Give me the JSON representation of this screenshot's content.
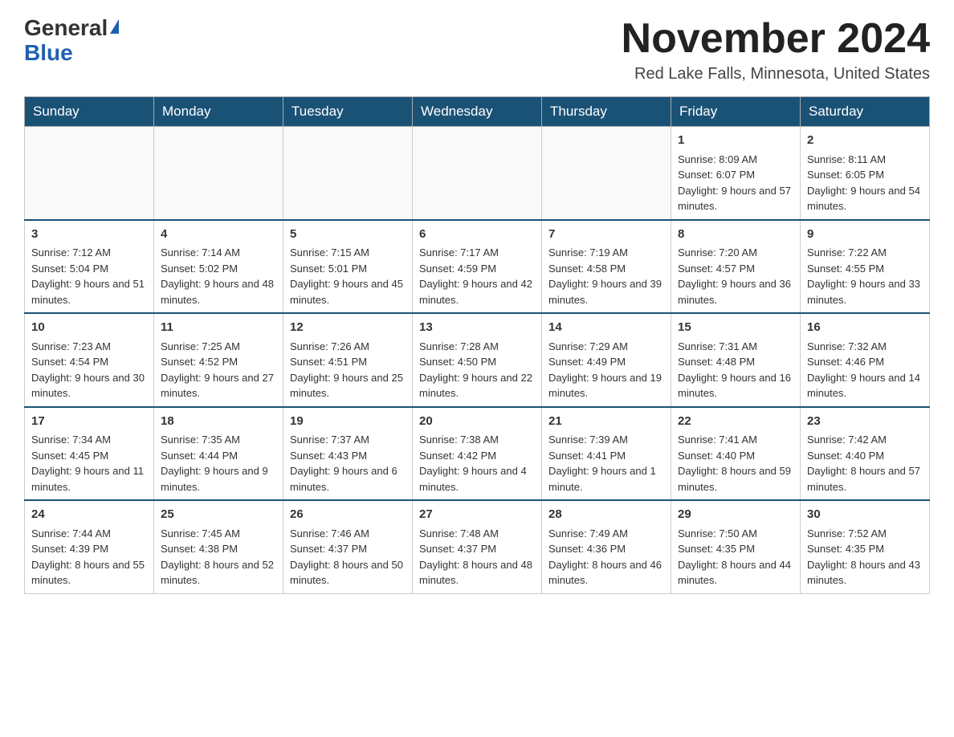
{
  "logo": {
    "general": "General",
    "blue": "Blue"
  },
  "header": {
    "month": "November 2024",
    "location": "Red Lake Falls, Minnesota, United States"
  },
  "weekdays": [
    "Sunday",
    "Monday",
    "Tuesday",
    "Wednesday",
    "Thursday",
    "Friday",
    "Saturday"
  ],
  "weeks": [
    [
      {
        "day": "",
        "data": ""
      },
      {
        "day": "",
        "data": ""
      },
      {
        "day": "",
        "data": ""
      },
      {
        "day": "",
        "data": ""
      },
      {
        "day": "",
        "data": ""
      },
      {
        "day": "1",
        "data": "Sunrise: 8:09 AM\nSunset: 6:07 PM\nDaylight: 9 hours and 57 minutes."
      },
      {
        "day": "2",
        "data": "Sunrise: 8:11 AM\nSunset: 6:05 PM\nDaylight: 9 hours and 54 minutes."
      }
    ],
    [
      {
        "day": "3",
        "data": "Sunrise: 7:12 AM\nSunset: 5:04 PM\nDaylight: 9 hours and 51 minutes."
      },
      {
        "day": "4",
        "data": "Sunrise: 7:14 AM\nSunset: 5:02 PM\nDaylight: 9 hours and 48 minutes."
      },
      {
        "day": "5",
        "data": "Sunrise: 7:15 AM\nSunset: 5:01 PM\nDaylight: 9 hours and 45 minutes."
      },
      {
        "day": "6",
        "data": "Sunrise: 7:17 AM\nSunset: 4:59 PM\nDaylight: 9 hours and 42 minutes."
      },
      {
        "day": "7",
        "data": "Sunrise: 7:19 AM\nSunset: 4:58 PM\nDaylight: 9 hours and 39 minutes."
      },
      {
        "day": "8",
        "data": "Sunrise: 7:20 AM\nSunset: 4:57 PM\nDaylight: 9 hours and 36 minutes."
      },
      {
        "day": "9",
        "data": "Sunrise: 7:22 AM\nSunset: 4:55 PM\nDaylight: 9 hours and 33 minutes."
      }
    ],
    [
      {
        "day": "10",
        "data": "Sunrise: 7:23 AM\nSunset: 4:54 PM\nDaylight: 9 hours and 30 minutes."
      },
      {
        "day": "11",
        "data": "Sunrise: 7:25 AM\nSunset: 4:52 PM\nDaylight: 9 hours and 27 minutes."
      },
      {
        "day": "12",
        "data": "Sunrise: 7:26 AM\nSunset: 4:51 PM\nDaylight: 9 hours and 25 minutes."
      },
      {
        "day": "13",
        "data": "Sunrise: 7:28 AM\nSunset: 4:50 PM\nDaylight: 9 hours and 22 minutes."
      },
      {
        "day": "14",
        "data": "Sunrise: 7:29 AM\nSunset: 4:49 PM\nDaylight: 9 hours and 19 minutes."
      },
      {
        "day": "15",
        "data": "Sunrise: 7:31 AM\nSunset: 4:48 PM\nDaylight: 9 hours and 16 minutes."
      },
      {
        "day": "16",
        "data": "Sunrise: 7:32 AM\nSunset: 4:46 PM\nDaylight: 9 hours and 14 minutes."
      }
    ],
    [
      {
        "day": "17",
        "data": "Sunrise: 7:34 AM\nSunset: 4:45 PM\nDaylight: 9 hours and 11 minutes."
      },
      {
        "day": "18",
        "data": "Sunrise: 7:35 AM\nSunset: 4:44 PM\nDaylight: 9 hours and 9 minutes."
      },
      {
        "day": "19",
        "data": "Sunrise: 7:37 AM\nSunset: 4:43 PM\nDaylight: 9 hours and 6 minutes."
      },
      {
        "day": "20",
        "data": "Sunrise: 7:38 AM\nSunset: 4:42 PM\nDaylight: 9 hours and 4 minutes."
      },
      {
        "day": "21",
        "data": "Sunrise: 7:39 AM\nSunset: 4:41 PM\nDaylight: 9 hours and 1 minute."
      },
      {
        "day": "22",
        "data": "Sunrise: 7:41 AM\nSunset: 4:40 PM\nDaylight: 8 hours and 59 minutes."
      },
      {
        "day": "23",
        "data": "Sunrise: 7:42 AM\nSunset: 4:40 PM\nDaylight: 8 hours and 57 minutes."
      }
    ],
    [
      {
        "day": "24",
        "data": "Sunrise: 7:44 AM\nSunset: 4:39 PM\nDaylight: 8 hours and 55 minutes."
      },
      {
        "day": "25",
        "data": "Sunrise: 7:45 AM\nSunset: 4:38 PM\nDaylight: 8 hours and 52 minutes."
      },
      {
        "day": "26",
        "data": "Sunrise: 7:46 AM\nSunset: 4:37 PM\nDaylight: 8 hours and 50 minutes."
      },
      {
        "day": "27",
        "data": "Sunrise: 7:48 AM\nSunset: 4:37 PM\nDaylight: 8 hours and 48 minutes."
      },
      {
        "day": "28",
        "data": "Sunrise: 7:49 AM\nSunset: 4:36 PM\nDaylight: 8 hours and 46 minutes."
      },
      {
        "day": "29",
        "data": "Sunrise: 7:50 AM\nSunset: 4:35 PM\nDaylight: 8 hours and 44 minutes."
      },
      {
        "day": "30",
        "data": "Sunrise: 7:52 AM\nSunset: 4:35 PM\nDaylight: 8 hours and 43 minutes."
      }
    ]
  ]
}
